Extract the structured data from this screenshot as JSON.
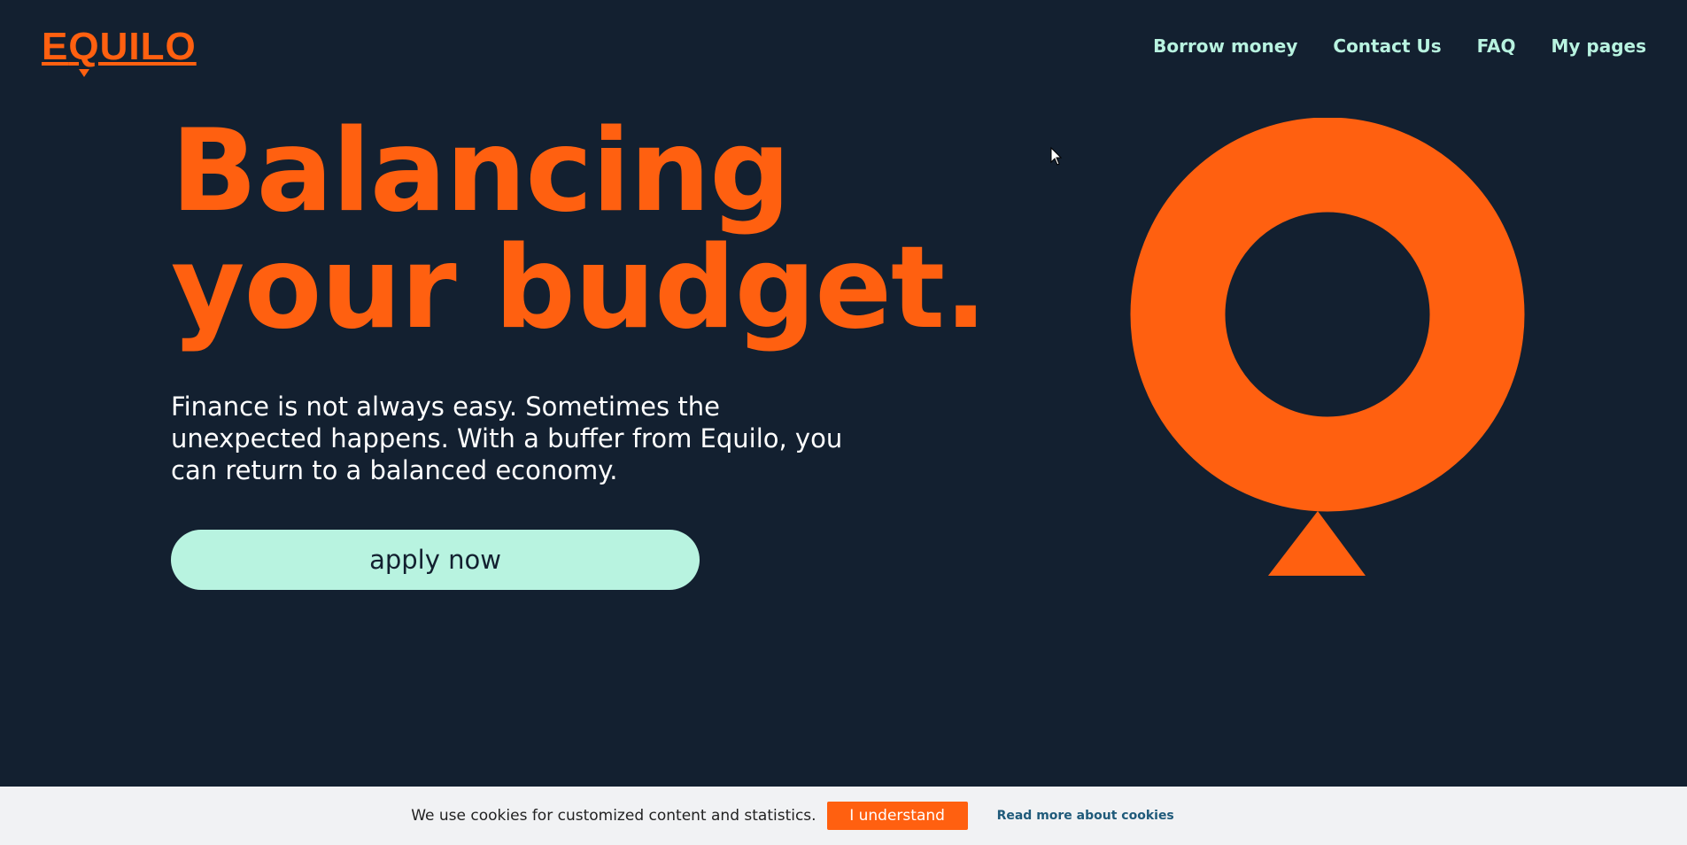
{
  "brand": {
    "logo_prefix": "E",
    "logo_pin_letter": "Q",
    "logo_suffix": "UILO",
    "accent_color": "#ff6010"
  },
  "nav": {
    "items": [
      {
        "label": "Borrow money"
      },
      {
        "label": "Contact Us"
      },
      {
        "label": "FAQ"
      },
      {
        "label": "My pages"
      }
    ]
  },
  "hero": {
    "headline_line1": "Balancing",
    "headline_line2": "your budget.",
    "intro": "Finance is not always easy. Sometimes the unexpected happens. With a buffer from Equilo, you can return to a balanced economy.",
    "cta_label": "apply now"
  },
  "cookie": {
    "message": "We use cookies for customized content and statistics.",
    "accept_label": "I understand",
    "read_more_label": "Read more about cookies"
  },
  "colors": {
    "background": "#132030",
    "mint": "#b8f3e0",
    "orange": "#ff6010",
    "cookie_bar": "#f1f2f4"
  },
  "icons": {
    "hero_graphic": "balloon-icon",
    "pointer": "cursor-icon"
  }
}
